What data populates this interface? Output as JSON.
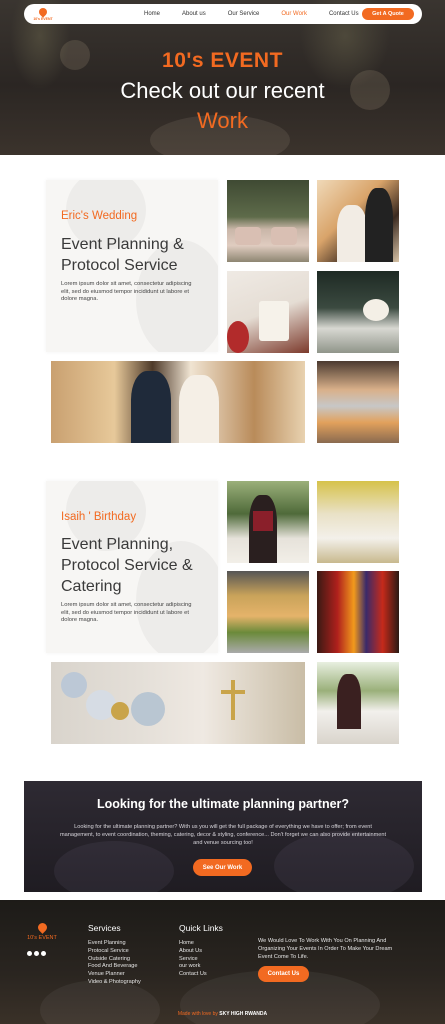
{
  "nav": {
    "logo_text": "10's EVENT",
    "links": [
      "Home",
      "About us",
      "Our Service",
      "Our Work",
      "Contact Us"
    ],
    "active": "Our Work",
    "cta": "Get A Quote"
  },
  "hero": {
    "title": "10's EVENT",
    "line1": "Check out our recent",
    "line2": "Work"
  },
  "projects": [
    {
      "kicker": "Eric's Wedding",
      "title": "Event Planning & Protocol Service",
      "body": "Lorem ipsum dolor sit amet, consectetur adipiscing elit, sed do eiusmod tempor incididunt ut labore et dolore magna."
    },
    {
      "kicker": "Isaih ' Birthday",
      "title": "Event Planning, Protocol Service & Catering",
      "body": "Lorem ipsum dolor sit amet, consectetur adipiscing elit, sed do eiusmod tempor incididunt ut labore et dolore magna."
    }
  ],
  "cta": {
    "title": "Looking for the ultimate planning partner?",
    "text": "Looking for the ultimate planning partner? With us you will get the full package of everything we have to offer; from event management, to event coordination, theming, catering, decor & styling, conference... Don't forget we can also provide entertainment and venue sourcing too!",
    "button": "See Our Work"
  },
  "footer": {
    "logo_text": "10's EVENT",
    "services_heading": "Services",
    "services": [
      "Event Planning",
      "Protocal Service",
      "Outside Catering",
      "Food And Beverage",
      "Venue Planner",
      "Video & Photography"
    ],
    "links_heading": "Quick Links",
    "links": [
      "Home",
      "About Us",
      "Service",
      "our work",
      "Contact Us"
    ],
    "blurb": "We Would Love To Work With You On Planning And Organizing Your Events In Order To Make Your Dream Event Come To Life.",
    "button": "Contact Us",
    "credit_prefix": "Made with love by",
    "credit_brand": "SKY HIGH RWANDA"
  },
  "colors": {
    "accent": "#f26a21",
    "dark": "#2b2623"
  }
}
